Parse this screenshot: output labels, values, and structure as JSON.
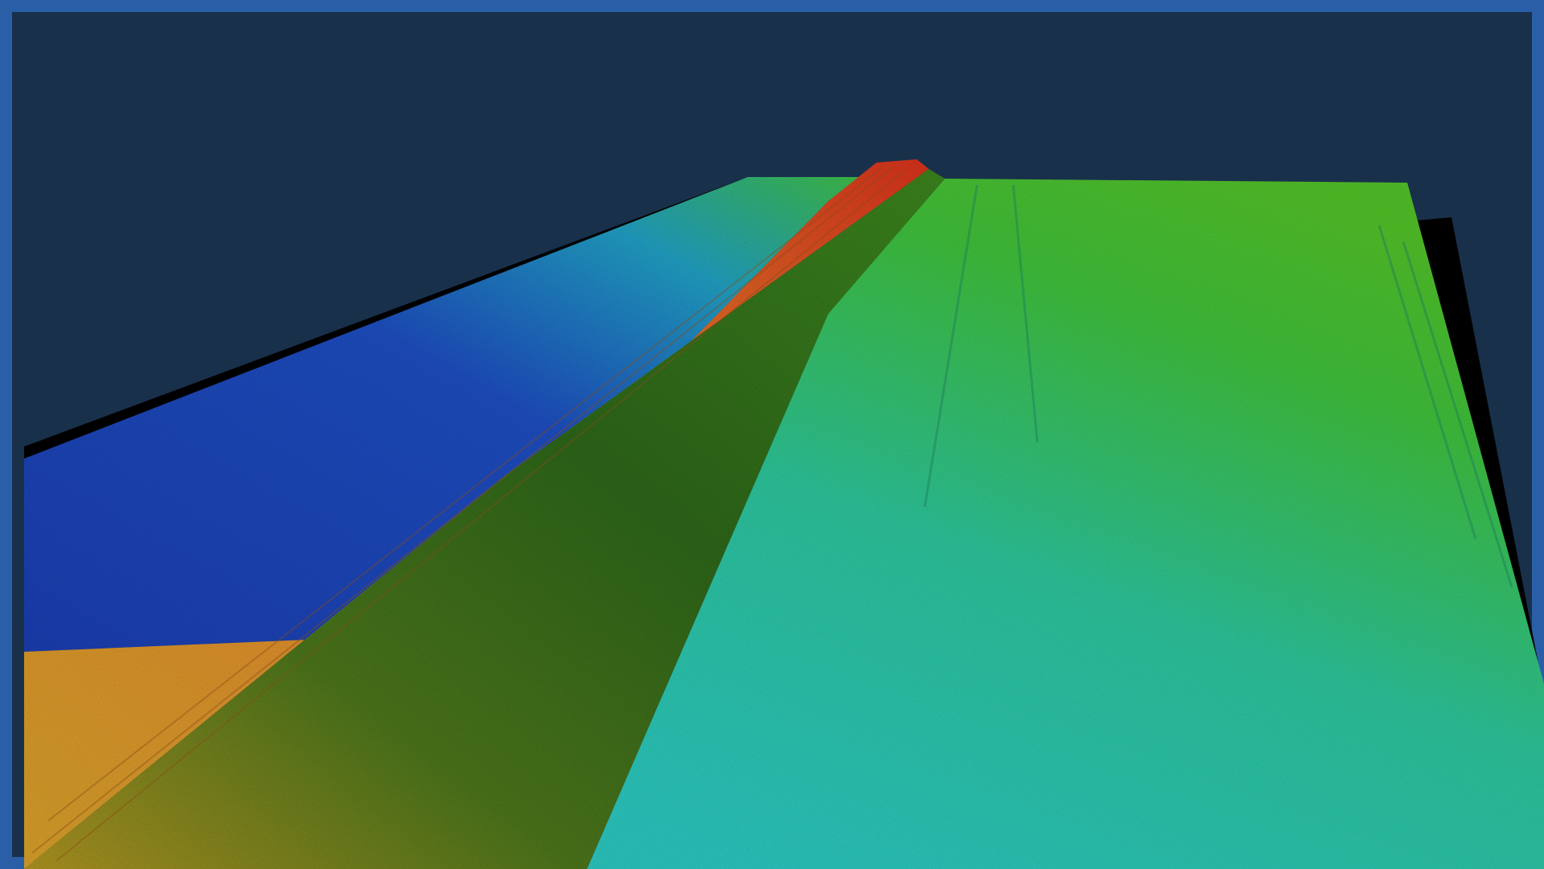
{
  "scene": {
    "kind": "3D bathymetric terrain render",
    "colors": {
      "frame": "#2a5ea6",
      "sky": "#19304b",
      "deep": "#1d3fb8",
      "mid": "#1fc0b2",
      "shallow_green": "#3fb52a",
      "ridge_orange": "#e07a28",
      "ridge_red": "#d8341e",
      "shadow_base": "#000000"
    },
    "colormap": [
      "#1d3fb8",
      "#1fc0b2",
      "#3fb52a",
      "#d6a82a",
      "#e07a28",
      "#d8341e"
    ]
  }
}
